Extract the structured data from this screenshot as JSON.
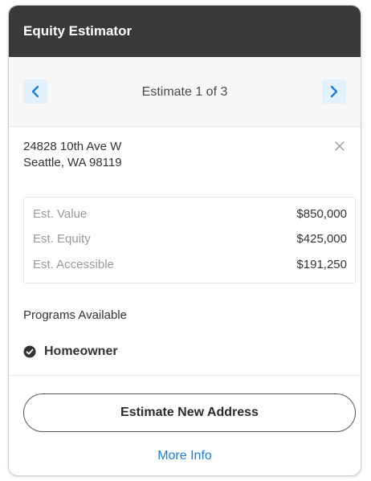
{
  "header": {
    "title": "Equity Estimator"
  },
  "navigation": {
    "label": "Estimate 1 of 3",
    "prev_icon": "chevron-left-icon",
    "next_icon": "chevron-right-icon"
  },
  "address": {
    "line1": "24828 10th Ave W",
    "line2": "Seattle, WA 98119",
    "close_icon": "close-icon"
  },
  "estimates": [
    {
      "label": "Est. Value",
      "value": "$850,000"
    },
    {
      "label": "Est. Equity",
      "value": "$425,000"
    },
    {
      "label": "Est. Accessible",
      "value": "$191,250"
    }
  ],
  "programs": {
    "title": "Programs Available",
    "items": [
      {
        "label": "Homeowner",
        "icon": "check-circle-icon"
      }
    ]
  },
  "actions": {
    "primary_label": "Estimate New Address",
    "more_info_label": "More Info"
  },
  "colors": {
    "header_bg": "#3a3a3a",
    "accent": "#1e7fd6",
    "nav_button_bg": "#e1f0fb"
  }
}
